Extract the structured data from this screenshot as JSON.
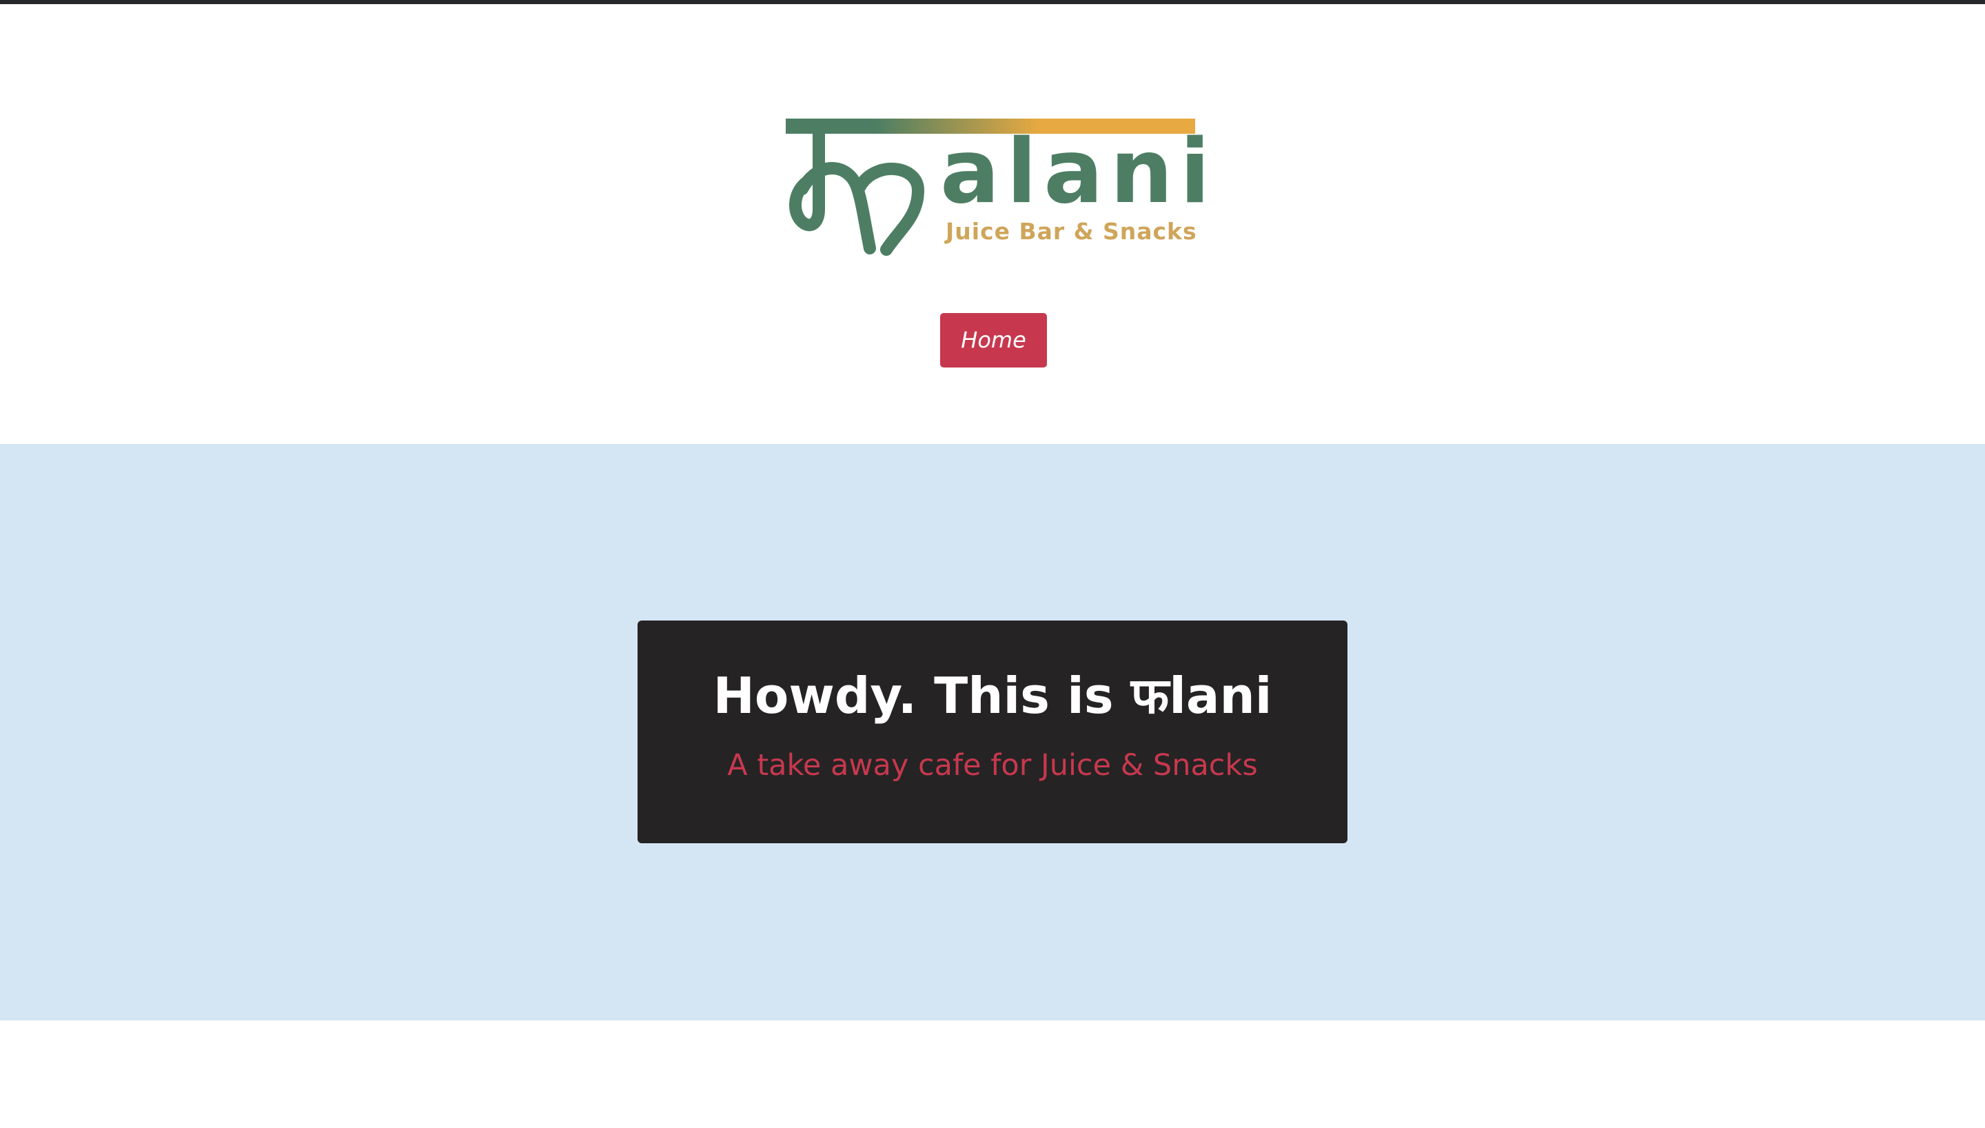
{
  "header": {
    "logo": {
      "wordmark": "फalani",
      "tagline": "Juice Bar & Snacks",
      "colors": {
        "green": "#4d7e63",
        "gold": "#e7a941",
        "tagline": "#cfa55a"
      }
    },
    "nav": {
      "home_label": "Home",
      "accent": "#c7384e"
    }
  },
  "hero": {
    "background": "#d4e6f4",
    "title": "Howdy. This is फlani",
    "subtitle": "A take away cafe for Juice & Snacks"
  }
}
